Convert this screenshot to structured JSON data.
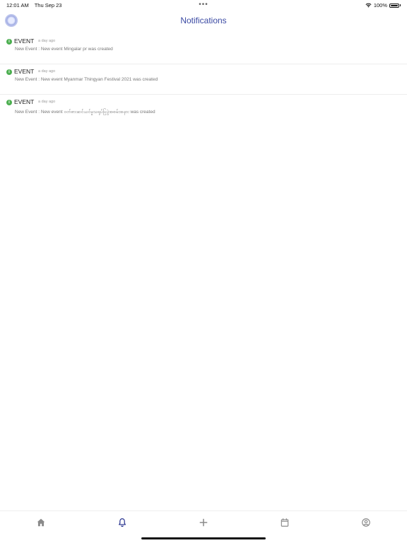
{
  "status_bar": {
    "time": "12:01 AM",
    "date": "Thu Sep 23",
    "multitask_dots": "•••",
    "battery_percent": "100%"
  },
  "header": {
    "title": "Notifications"
  },
  "notifications": [
    {
      "type": "EVENT",
      "time": "a day ago",
      "description": "New Event : New event Mingalar pr was created"
    },
    {
      "type": "EVENT",
      "time": "a day ago",
      "description": "New Event : New event Myanmar Thingyan Festival 2021 was created"
    },
    {
      "type": "EVENT",
      "time": "a day ago",
      "description": "New Event : New event ဝတ်စားဆင်ယင်မှုသရုပ်ပြပွဲအစမ်းအနား was created"
    }
  ],
  "tab_bar": {
    "active": "notifications",
    "tabs": [
      {
        "id": "home",
        "icon": "home-icon"
      },
      {
        "id": "notifications",
        "icon": "bell-icon"
      },
      {
        "id": "add",
        "icon": "plus-icon"
      },
      {
        "id": "calendar",
        "icon": "calendar-icon"
      },
      {
        "id": "profile",
        "icon": "user-circle-icon"
      }
    ],
    "active_color": "#1f2a8a",
    "inactive_color": "#8a8a8a"
  },
  "colors": {
    "title": "#3b4aa3",
    "info_badge": "#4caf50"
  }
}
